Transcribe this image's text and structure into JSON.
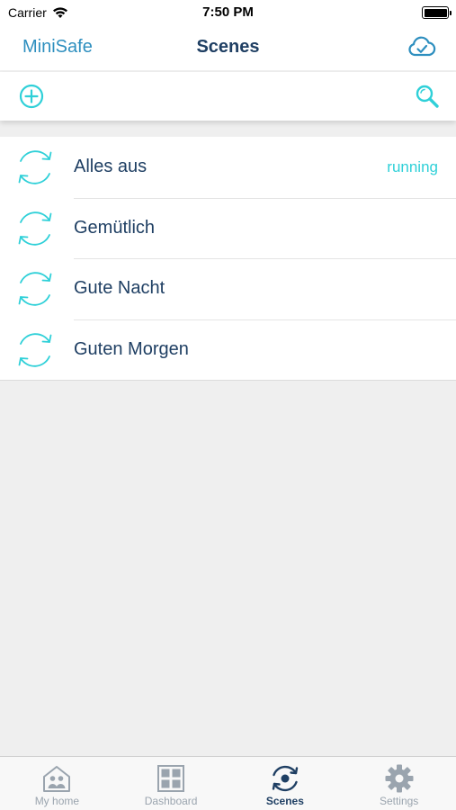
{
  "status_bar": {
    "carrier": "Carrier",
    "time": "7:50 PM"
  },
  "nav": {
    "back_label": "MiniSafe",
    "title": "Scenes"
  },
  "scenes": [
    {
      "name": "Alles aus",
      "status": "running"
    },
    {
      "name": "Gemütlich",
      "status": ""
    },
    {
      "name": "Gute Nacht",
      "status": ""
    },
    {
      "name": "Guten Morgen",
      "status": ""
    }
  ],
  "tabs": [
    {
      "label": "My home",
      "icon": "home-icon",
      "active": false
    },
    {
      "label": "Dashboard",
      "icon": "dashboard-icon",
      "active": false
    },
    {
      "label": "Scenes",
      "icon": "scenes-icon",
      "active": true
    },
    {
      "label": "Settings",
      "icon": "gear-icon",
      "active": false
    }
  ],
  "colors": {
    "accent": "#2fd0d8",
    "title": "#1f3f63",
    "link": "#2e8fbf",
    "background": "#efefef",
    "tab_inactive": "#9aa4ae"
  }
}
